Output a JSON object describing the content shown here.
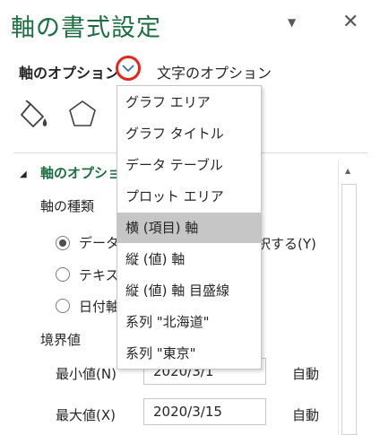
{
  "pane": {
    "title": "軸の書式設定",
    "tab_axis_options": "軸のオプション",
    "tab_text_options": "文字のオプション",
    "icons": [
      "fill-line-icon",
      "effects-pentagon-icon"
    ]
  },
  "menu": {
    "items": [
      {
        "label": "グラフ エリア",
        "selected": false
      },
      {
        "label": "グラフ タイトル",
        "selected": false
      },
      {
        "label": "データ テーブル",
        "selected": false
      },
      {
        "label": "プロット エリア",
        "selected": false
      },
      {
        "label": "横 (項目) 軸",
        "selected": true
      },
      {
        "label": "縦 (値) 軸",
        "selected": false
      },
      {
        "label": "縦 (値) 軸 目盛線",
        "selected": false
      },
      {
        "label": "系列 \"北海道\"",
        "selected": false
      },
      {
        "label": "系列 \"東京\"",
        "selected": false
      }
    ]
  },
  "section": {
    "title": "軸のオプション",
    "axis_type_label": "軸の種類",
    "radio_data": "データ",
    "radio_data_tail": "択する(Y)",
    "radio_text": "テキス",
    "radio_date": "日付軸",
    "bounds_label": "境界値",
    "min_label": "最小値(N)",
    "min_value": "2020/3/1",
    "min_auto": "自動",
    "max_label": "最大値(X)",
    "max_value": "2020/3/15",
    "max_auto": "自動"
  },
  "colors": {
    "title_green": "#1d6f42",
    "highlight_red": "#e8241a",
    "selected_gray": "#c6c6c6"
  }
}
